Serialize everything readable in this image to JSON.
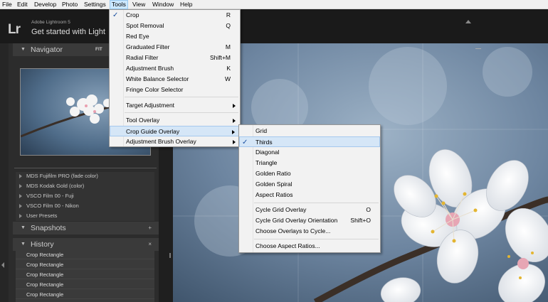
{
  "menubar": {
    "items": [
      {
        "label": "File"
      },
      {
        "label": "Edit"
      },
      {
        "label": "Develop"
      },
      {
        "label": "Photo"
      },
      {
        "label": "Settings"
      },
      {
        "label": "Tools"
      },
      {
        "label": "View"
      },
      {
        "label": "Window"
      },
      {
        "label": "Help"
      }
    ]
  },
  "header": {
    "logo": "Lr",
    "product": "Adobe Lightroom 5",
    "title": "Get started with Light"
  },
  "navigator": {
    "title": "Navigator",
    "fit": "FIT"
  },
  "presets": [
    "MDS Fujifilm PRO (fade color)",
    "MDS Kodak Gold (color)",
    "VSCO Film 00 - Fuji",
    "VSCO Film 00 - Nikon",
    "User Presets"
  ],
  "snapshots": {
    "title": "Snapshots",
    "action": "+"
  },
  "history": {
    "title": "History",
    "action": "×",
    "rows": [
      "Crop Rectangle",
      "Crop Rectangle",
      "Crop Rectangle",
      "Crop Rectangle",
      "Crop Rectangle"
    ]
  },
  "tools_menu": {
    "items": [
      {
        "label": "Crop",
        "shortcut": "R",
        "checked": true
      },
      {
        "label": "Spot Removal",
        "shortcut": "Q"
      },
      {
        "label": "Red Eye",
        "shortcut": ""
      },
      {
        "label": "Graduated Filter",
        "shortcut": "M"
      },
      {
        "label": "Radial Filter",
        "shortcut": "Shift+M"
      },
      {
        "label": "Adjustment Brush",
        "shortcut": "K"
      },
      {
        "label": "White Balance Selector",
        "shortcut": "W"
      },
      {
        "label": "Fringe Color Selector",
        "shortcut": ""
      },
      {
        "label": "Target Adjustment",
        "submenu": true
      },
      {
        "label": "Tool Overlay",
        "submenu": true
      },
      {
        "label": "Crop Guide Overlay",
        "submenu": true,
        "highlighted": true
      },
      {
        "label": "Adjustment Brush Overlay",
        "submenu": true
      }
    ]
  },
  "crop_guide_menu": {
    "items": [
      {
        "label": "Grid",
        "shortcut": ""
      },
      {
        "label": "Thirds",
        "shortcut": "",
        "checked": true,
        "highlighted": true
      },
      {
        "label": "Diagonal",
        "shortcut": ""
      },
      {
        "label": "Triangle",
        "shortcut": ""
      },
      {
        "label": "Golden Ratio",
        "shortcut": ""
      },
      {
        "label": "Golden Spiral",
        "shortcut": ""
      },
      {
        "label": "Aspect Ratios",
        "shortcut": ""
      },
      {
        "label": "Cycle Grid Overlay",
        "shortcut": "O"
      },
      {
        "label": "Cycle Grid Overlay Orientation",
        "shortcut": "Shift+O"
      },
      {
        "label": "Choose Overlays to Cycle...",
        "shortcut": ""
      },
      {
        "label": "Choose Aspect Ratios...",
        "shortcut": ""
      }
    ]
  },
  "icons": {
    "check": "✓"
  }
}
